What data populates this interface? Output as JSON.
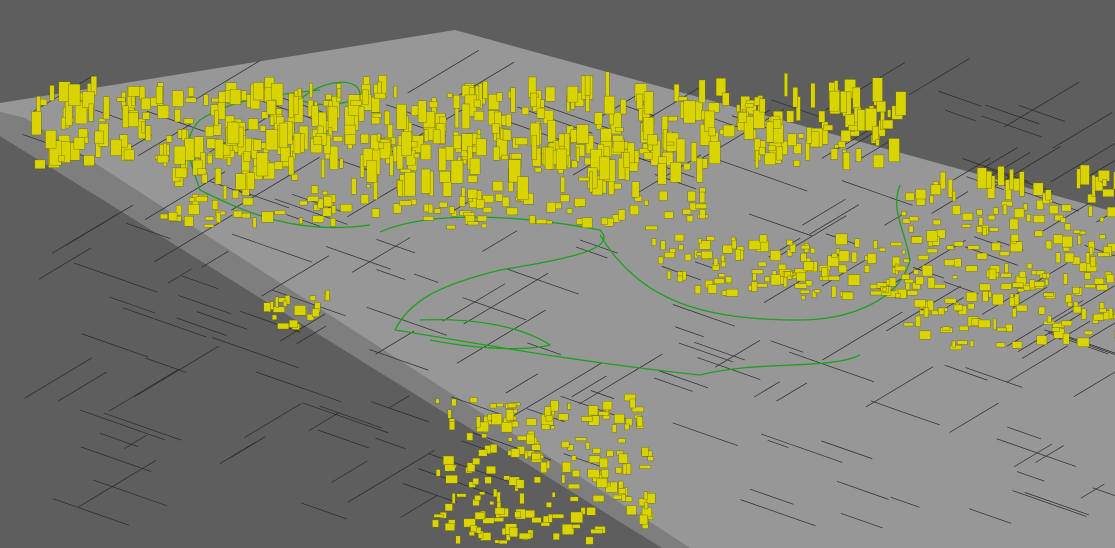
{
  "viewport": {
    "colors": {
      "background": "#5e5e5e",
      "plane_top": "#979797",
      "plane_side": "#7e7e7e",
      "buildings": "#d9d400",
      "roads": "#2a2a2a",
      "green_lines": "#1ea01e"
    }
  }
}
